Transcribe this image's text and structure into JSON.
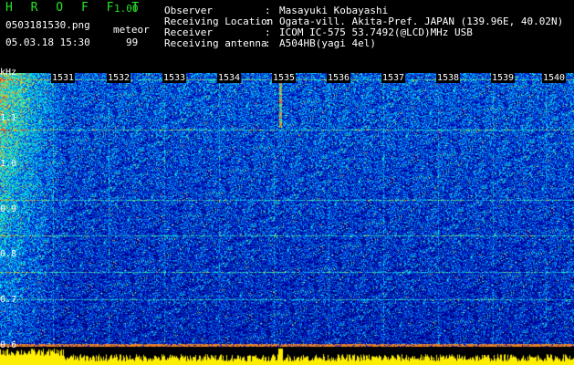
{
  "app": {
    "title": "H R O F F T",
    "version": "1.00"
  },
  "file": {
    "name": "0503181530.png",
    "datetime": "05.03.18 15:30"
  },
  "mode": {
    "label": "meteor",
    "count": "99"
  },
  "info": [
    {
      "label": "Observer",
      "value": "Masayuki Kobayashi"
    },
    {
      "label": "Receiving Location",
      "value": "Ogata-vill. Akita-Pref. JAPAN (139.96E, 40.02N)"
    },
    {
      "label": "Receiver",
      "value": "ICOM IC-575 53.7492(@LCD)MHz USB"
    },
    {
      "label": "Receiving antenna",
      "value": "A504HB(yagi 4el)"
    }
  ],
  "info_sep": ":",
  "axis": {
    "unit": "kHz",
    "y_ticks": [
      "1.1",
      "1.0",
      "0.9",
      "0.8",
      "0.7",
      "0.6"
    ],
    "x_ticks": [
      "1531",
      "1532",
      "1533",
      "1534",
      "1535",
      "1536",
      "1537",
      "1538",
      "1539",
      "1540"
    ]
  }
}
